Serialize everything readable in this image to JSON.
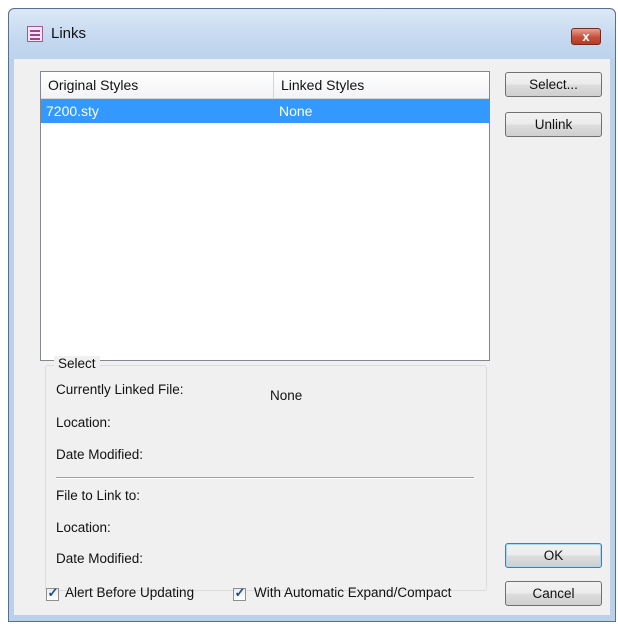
{
  "window": {
    "title": "Links",
    "close_icon": "x"
  },
  "list": {
    "columns": [
      "Original Styles",
      "Linked Styles"
    ],
    "rows": [
      {
        "original": "7200.sty",
        "linked": "None",
        "selected": true
      }
    ]
  },
  "buttons": {
    "select": "Select...",
    "unlink": "Unlink",
    "ok": "OK",
    "cancel": "Cancel"
  },
  "group": {
    "title": "Select",
    "currently_linked_label": "Currently Linked File:",
    "currently_linked_value": "None",
    "location_label": "Location:",
    "date_modified_label": "Date Modified:",
    "file_to_link_label": "File to Link to:",
    "location2_label": "Location:",
    "date_modified2_label": "Date Modified:"
  },
  "options": {
    "alert_label": "Alert Before Updating",
    "alert_checked": true,
    "expand_label": "With Automatic Expand/Compact",
    "expand_checked": true
  },
  "colors": {
    "selection": "#3399ff",
    "dialog_bg": "#f0f0f0",
    "close_button": "#c7503b"
  }
}
